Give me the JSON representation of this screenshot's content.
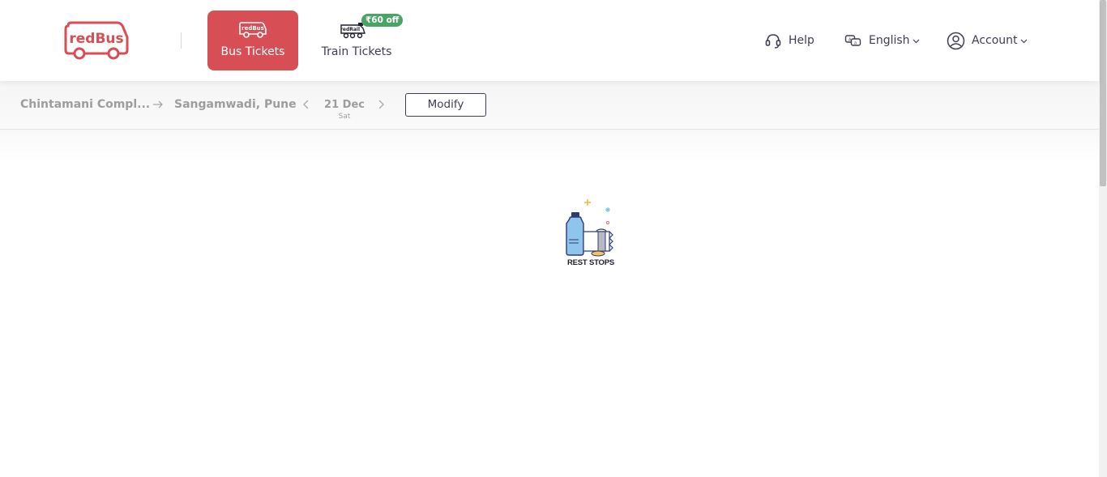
{
  "brand": {
    "logo_text": "redBus"
  },
  "tabs": [
    {
      "label": "Bus Tickets",
      "icon": "bus-icon",
      "icon_text": "redBus",
      "active": true,
      "color": "#d84e55"
    },
    {
      "label": "Train Tickets",
      "icon": "train-icon",
      "icon_text": "redRail",
      "badge": "₹60 off",
      "badge_color": "#4aa564"
    }
  ],
  "nav": {
    "help": {
      "label": "Help",
      "icon": "headset-icon"
    },
    "language": {
      "label": "English",
      "icon": "language-icon"
    },
    "account": {
      "label": "Account",
      "icon": "user-icon"
    }
  },
  "search": {
    "from": "Chintamani Compl...",
    "to": "Sangamwadi, Pune",
    "date": "21 Dec",
    "day": "Sat",
    "modify_label": "Modify"
  },
  "loader": {
    "caption": "REST STOPS",
    "icon": "rest-stops-illustration"
  },
  "colors": {
    "brand_red": "#d84e55",
    "text_dark": "#3e3e52",
    "muted": "#9d9d9d",
    "offer_green": "#4aa564"
  }
}
